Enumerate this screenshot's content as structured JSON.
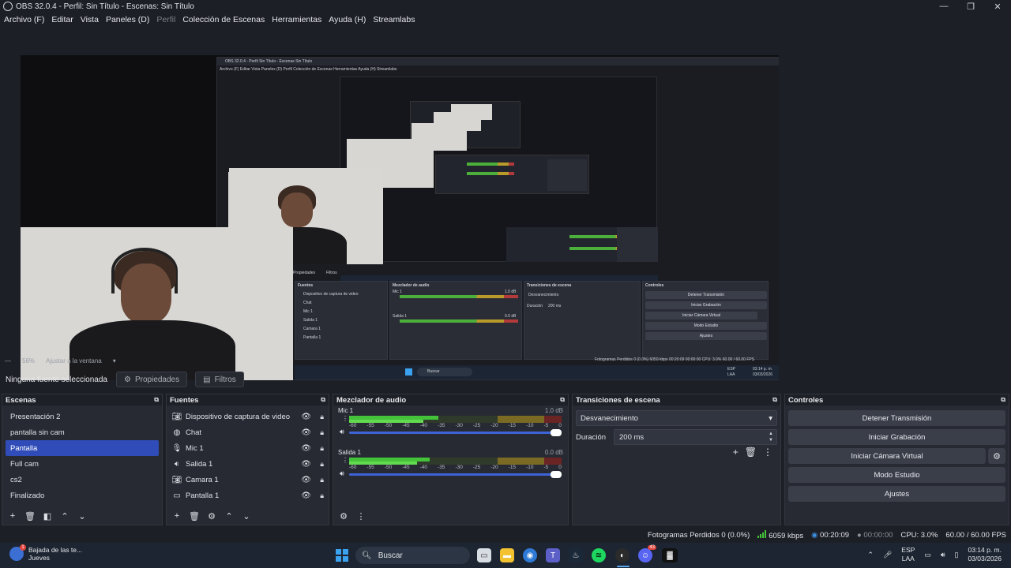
{
  "window": {
    "title": "OBS 32.0.4 - Perfil: Sin Título - Escenas: Sin Título",
    "controls": [
      "—",
      "❐",
      "✕"
    ]
  },
  "menu": [
    "Archivo (F)",
    "Editar",
    "Vista",
    "Paneles (D)",
    "Perfil",
    "Colección de Escenas",
    "Herramientas",
    "Ayuda (H)",
    "Streamlabs"
  ],
  "preview": {
    "zoom": "56%",
    "fit_label": "Ajustar a la ventana",
    "nested_title": "OBS 32.0.4 - Perfil Sin Título - Escenas Sin Título",
    "nested_menu": "Archivo (F)   Editar   Vista   Paneles (D)   Perfil   Colección de Escenas   Herramientas   Ayuda (H)   Streamlabs",
    "nested_docks": {
      "sources": "Fuentes",
      "mixer": "Mezclador de audio",
      "transitions": "Transiciones de escena",
      "controls": "Controles"
    },
    "nested_sources": [
      "Dispositivo de captura de video",
      "Chat",
      "Mic 1",
      "Salida 1",
      "Camara 1",
      "Pantalla 1"
    ],
    "nested_controls": [
      "Detener Transmisión",
      "Iniciar Grabación",
      "Iniciar Cámara Virtual",
      "Modo Estudio",
      "Ajustes"
    ],
    "nested_trans": "Desvanecimiento",
    "nested_duration_label": "Duración",
    "nested_duration": "200 ms",
    "nested_status": "Fotogramas Perdidos 0 (0.0%)    6059 kbps    00:20:09    00:00:00    CPU: 3.0%    60.00 / 60.00 FPS",
    "nested_search": "Buscar",
    "nested_tabs": [
      "Propiedades",
      "Filtros"
    ],
    "nested_mixer": [
      {
        "name": "Mic 1",
        "db": "1.0 dB"
      },
      {
        "name": "Salida 1",
        "db": "0.0 dB"
      }
    ],
    "nested_tray": {
      "lang": "ESP",
      "layout": "LAA",
      "time": "03:14 p. m.",
      "date": "03/03/2026"
    }
  },
  "source_bar": {
    "selected": "Ninguna fuente seleccionada",
    "properties": "Propiedades",
    "filters": "Filtros"
  },
  "docks": {
    "scenes": {
      "title": "Escenas",
      "items": [
        "Presentación 2",
        "pantalla sin cam",
        "Pantalla",
        "Full cam",
        "cs2",
        "Finalizado"
      ],
      "selected_index": 2
    },
    "sources": {
      "title": "Fuentes",
      "items": [
        {
          "label": "Dispositivo de captura de video",
          "icon": "camera-icon"
        },
        {
          "label": "Chat",
          "icon": "globe-icon"
        },
        {
          "label": "Mic 1",
          "icon": "microphone-icon"
        },
        {
          "label": "Salida 1",
          "icon": "speaker-icon"
        },
        {
          "label": "Camara 1",
          "icon": "camera-icon"
        },
        {
          "label": "Pantalla 1",
          "icon": "monitor-icon"
        }
      ]
    },
    "mixer": {
      "title": "Mezclador de audio",
      "scale": [
        "-60",
        "-55",
        "-50",
        "-45",
        "-40",
        "-35",
        "-30",
        "-25",
        "-20",
        "-15",
        "-10",
        "-5",
        "0"
      ],
      "channels": [
        {
          "name": "Mic 1",
          "db": "1.0 dB",
          "level_top": 0.42,
          "level_bottom": 0.35
        },
        {
          "name": "Salida 1",
          "db": "0.0 dB",
          "level_top": 0.38,
          "level_bottom": 0.32
        }
      ]
    },
    "transitions": {
      "title": "Transiciones de escena",
      "selected": "Desvanecimiento",
      "duration_label": "Duración",
      "duration": "200 ms"
    },
    "controls": {
      "title": "Controles",
      "buttons": [
        "Detener Transmisión",
        "Iniciar Grabación",
        "Iniciar Cámara Virtual",
        "Modo Estudio",
        "Ajustes"
      ]
    }
  },
  "status": {
    "dropped": "Fotogramas Perdidos 0 (0.0%)",
    "bitrate": "6059 kbps",
    "stream_time": "00:20:09",
    "rec_time": "00:00:00",
    "cpu": "CPU: 3.0%",
    "fps": "60.00 / 60.00 FPS"
  },
  "taskbar": {
    "weather_line1": "Bajada de las te...",
    "weather_line2": "Jueves",
    "weather_badge": "1",
    "search": "Buscar",
    "lang": "ESP",
    "layout": "LAA",
    "time": "03:14 p. m.",
    "date": "03/03/2026",
    "discord_badge": "43"
  },
  "colors": {
    "accent": "#2f4cb8",
    "panel": "#272a33",
    "background": "#1d1f26",
    "meter_green": "#43c23a",
    "volume_slider": "#3e63d6"
  }
}
